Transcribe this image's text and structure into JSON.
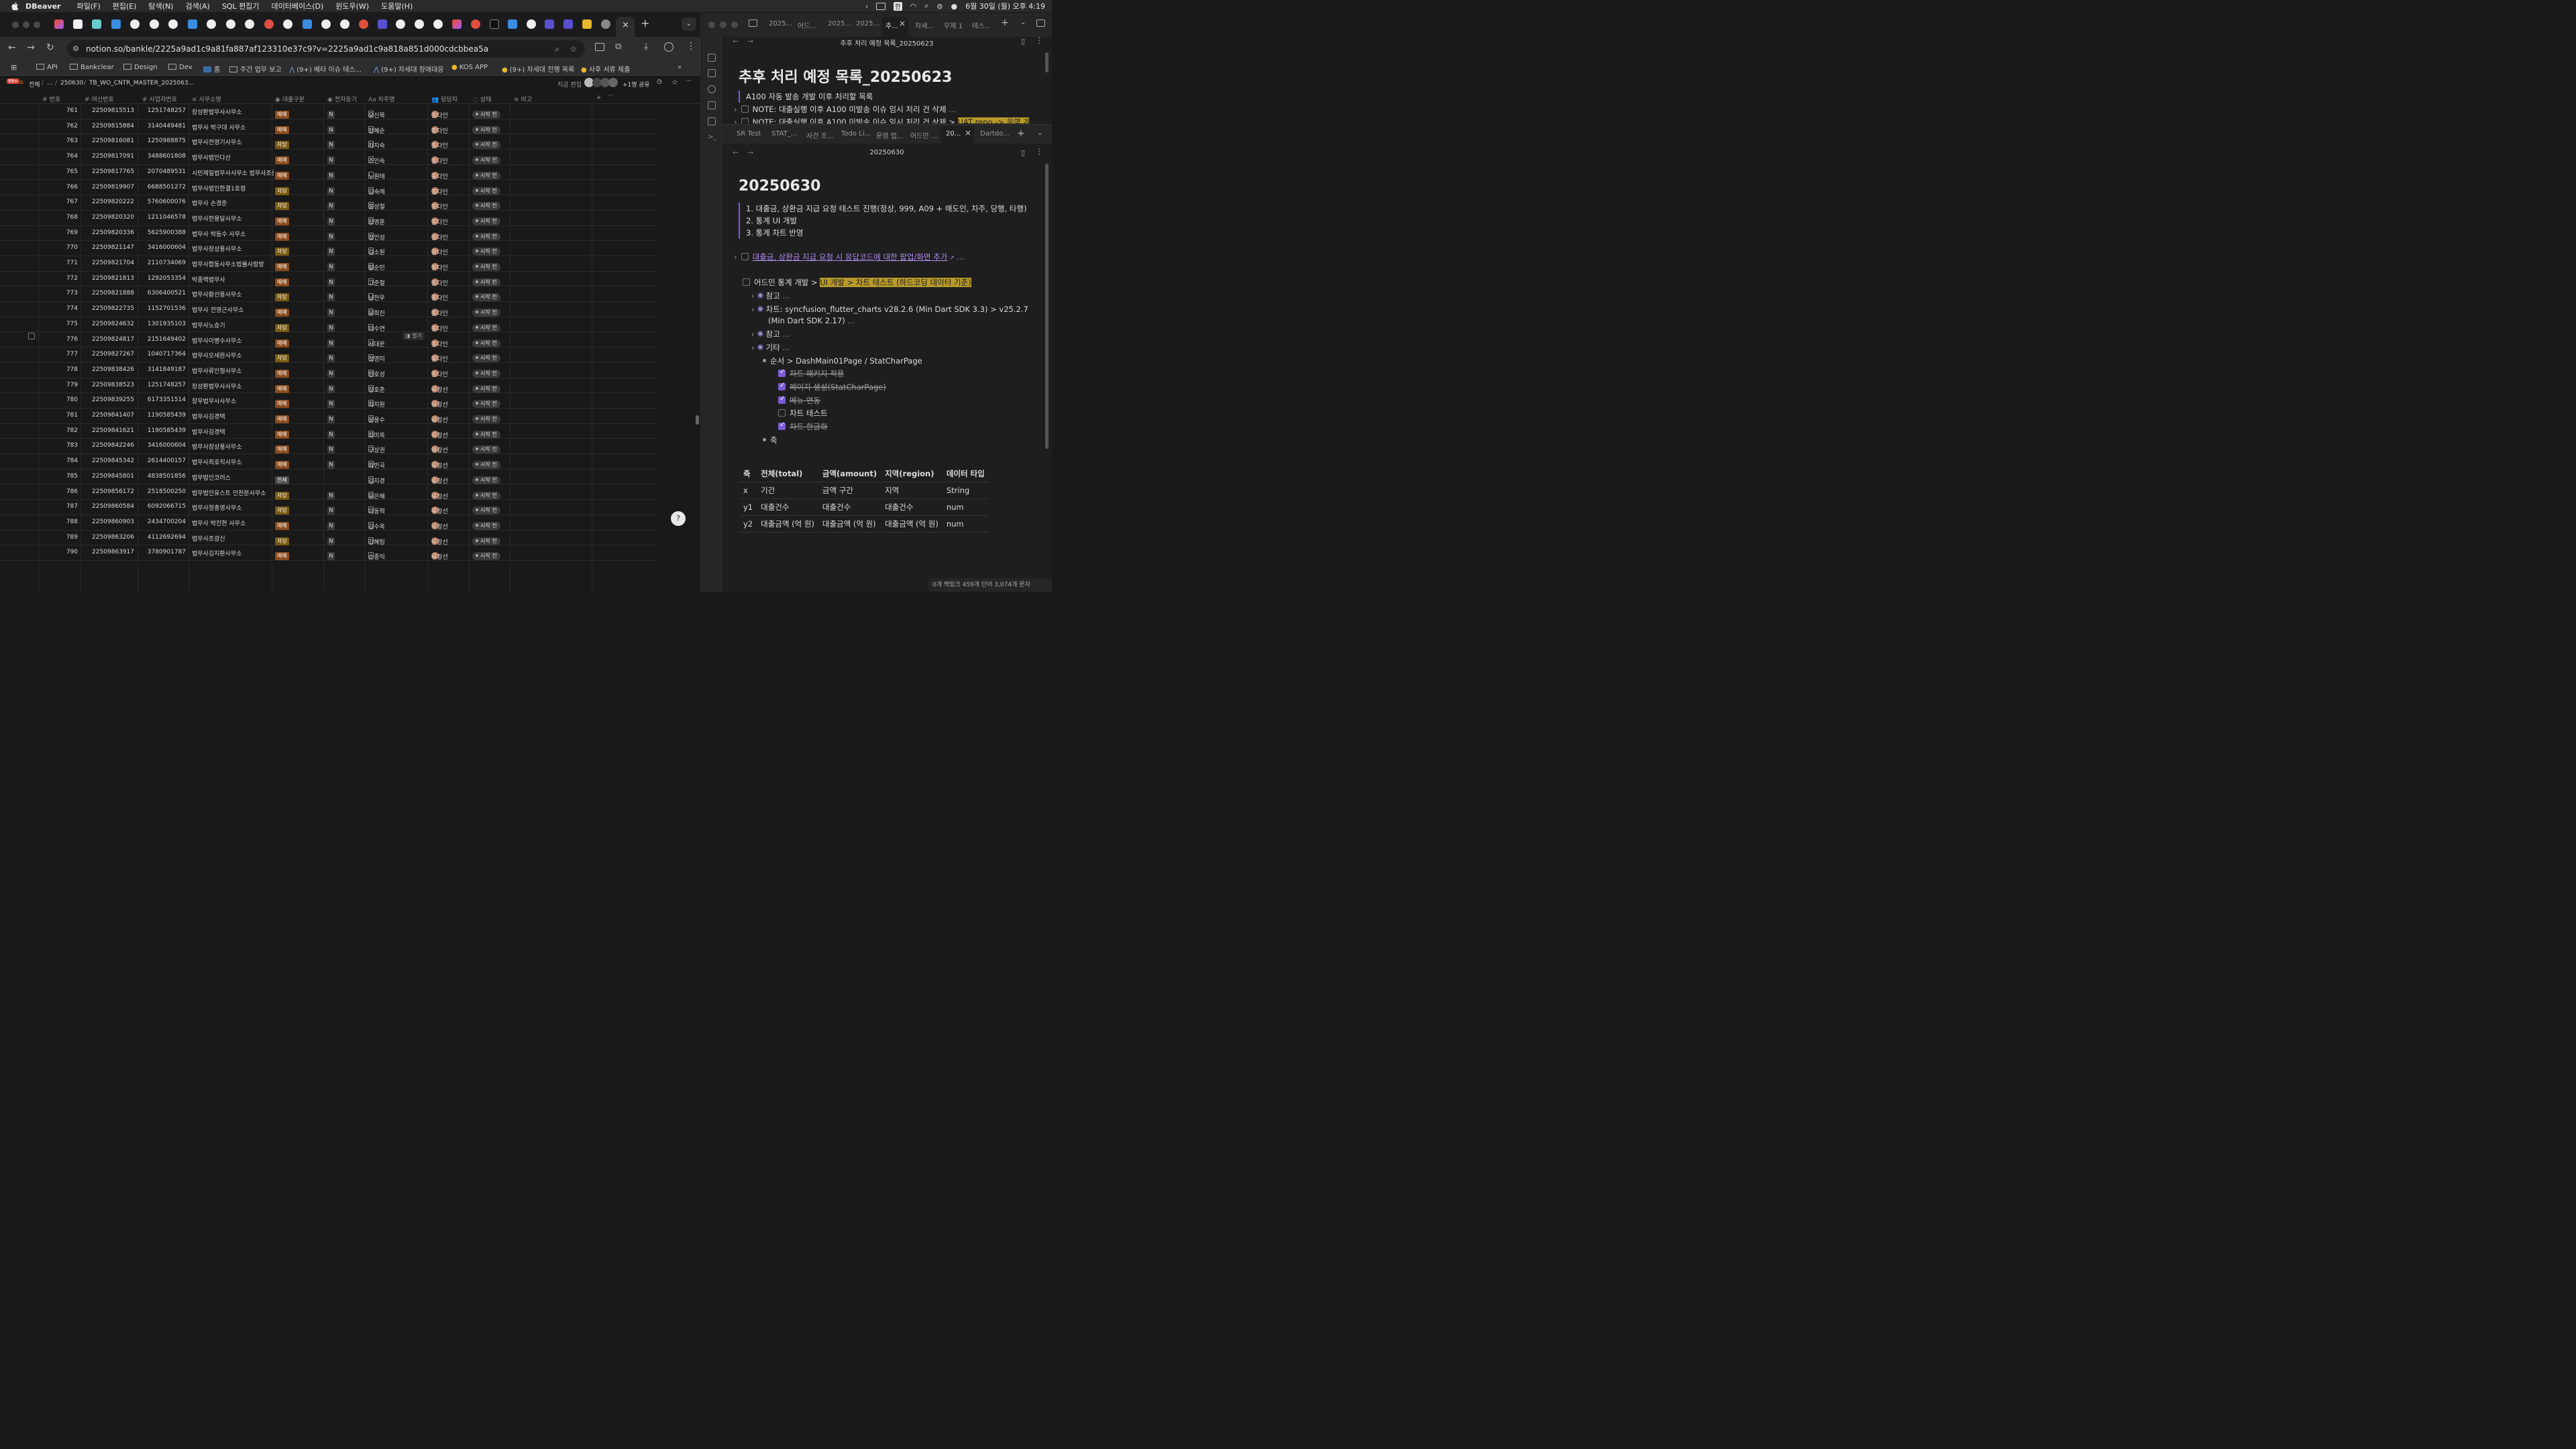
{
  "menubar": {
    "app": "DBeaver",
    "items": [
      "파일(F)",
      "편집(E)",
      "탐색(N)",
      "검색(A)",
      "SQL 편집기",
      "데이터베이스(D)",
      "윈도우(W)",
      "도움말(H)"
    ],
    "clock": "6월 30일 (월) 오후 4:19"
  },
  "browser": {
    "url": "notion.so/bankle/2225a9ad1c9a81fa887af123310e37c9?v=2225a9ad1c9a818a851d000cdcbbea5a",
    "bookmarks": [
      "API",
      "Bankclear",
      "Design",
      "Dev",
      "홈",
      "주간 업무 보고",
      "(9+) 베타 이슈 테스...",
      "(9+) 차세대 장애대응",
      "KOS APP",
      "(9+) 차세대 진행 목록",
      "사후 서류 제출"
    ]
  },
  "notion": {
    "breadcrumb": {
      "badge": "99+",
      "items": [
        "전체",
        "...",
        "250630",
        "TB_WO_CNTR_MASTER_2025063..."
      ],
      "edit_label": "지금 편집",
      "people_count": "+1명",
      "share": "공유"
    },
    "columns": [
      "번호",
      "여신번호",
      "사업자번호",
      "사무소명",
      "대출구분",
      "전자등기",
      "차주명",
      "담당자",
      "상태",
      "비고"
    ],
    "open_label": "열기",
    "rows": [
      {
        "no": "761",
        "loan": "22509815513",
        "biz": "1251748257",
        "office": "장성환법무사사무소",
        "type": "매매",
        "e": "N",
        "owner": "유신목",
        "mgr": "홍다인",
        "status": "시작 전"
      },
      {
        "no": "762",
        "loan": "22509815884",
        "biz": "3140449481",
        "office": "법무사 박구대 사무소",
        "type": "매매",
        "e": "N",
        "owner": "장혜순",
        "mgr": "홍다인",
        "status": "시작 전"
      },
      {
        "no": "763",
        "loan": "22509816081",
        "biz": "1250988875",
        "office": "법무사전영기사무소",
        "type": "자담",
        "e": "N",
        "owner": "차지숙",
        "mgr": "홍다인",
        "status": "시작 전"
      },
      {
        "no": "764",
        "loan": "22509817091",
        "biz": "3488601808",
        "office": "법무사법인다산",
        "type": "매매",
        "e": "N",
        "owner": "조인숙",
        "mgr": "홍다인",
        "status": "시작 전"
      },
      {
        "no": "765",
        "loan": "22509817765",
        "biz": "2070489531",
        "office": "시민제일법무사사무소 법무사조중일",
        "type": "매매",
        "e": "N",
        "owner": "노원태",
        "mgr": "홍다인",
        "status": "시작 전"
      },
      {
        "no": "766",
        "loan": "22509819907",
        "biz": "6688501272",
        "office": "법무사법인한결1호점",
        "type": "자담",
        "e": "N",
        "owner": "김숙례",
        "mgr": "홍다인",
        "status": "시작 전"
      },
      {
        "no": "767",
        "loan": "22509820222",
        "biz": "5760600076",
        "office": "법무사 손경준",
        "type": "자담",
        "e": "N",
        "owner": "홍성철",
        "mgr": "홍다인",
        "status": "시작 전"
      },
      {
        "no": "768",
        "loan": "22509820320",
        "biz": "1211046578",
        "office": "법무사한용달사무소",
        "type": "매매",
        "e": "N",
        "owner": "장영훈",
        "mgr": "홍다인",
        "status": "시작 전"
      },
      {
        "no": "769",
        "loan": "22509820336",
        "biz": "5625900388",
        "office": "법무사 박동수 사무소",
        "type": "매매",
        "e": "N",
        "owner": "정인성",
        "mgr": "홍다인",
        "status": "시작 전"
      },
      {
        "no": "770",
        "loan": "22509821147",
        "biz": "3416000604",
        "office": "법무사장상용사무소",
        "type": "자담",
        "e": "N",
        "owner": "김소원",
        "mgr": "홍다인",
        "status": "시작 전"
      },
      {
        "no": "771",
        "loan": "22509821704",
        "biz": "2110734069",
        "office": "법무사합동사무소법률사랑방",
        "type": "매매",
        "e": "N",
        "owner": "황순민",
        "mgr": "홍다인",
        "status": "시작 전"
      },
      {
        "no": "772",
        "loan": "22509821813",
        "biz": "1292053354",
        "office": "박종백법무사",
        "type": "매매",
        "e": "N",
        "owner": "고준철",
        "mgr": "홍다인",
        "status": "시작 전"
      },
      {
        "no": "773",
        "loan": "22509821888",
        "biz": "6306400521",
        "office": "법무사황선용사무소",
        "type": "자담",
        "e": "N",
        "owner": "남천우",
        "mgr": "홍다인",
        "status": "시작 전"
      },
      {
        "no": "774",
        "loan": "22509822735",
        "biz": "1152701536",
        "office": "법무사 전영근사무소",
        "type": "매매",
        "e": "N",
        "owner": "유희진",
        "mgr": "홍다인",
        "status": "시작 전"
      },
      {
        "no": "775",
        "loan": "22509824632",
        "biz": "1301935103",
        "office": "법무사노승기",
        "type": "자담",
        "e": "N",
        "owner": "이수연",
        "mgr": "홍다인",
        "status": "시작 전"
      },
      {
        "no": "776",
        "loan": "22509824817",
        "biz": "2151649402",
        "office": "법무사이병수사무소",
        "type": "매매",
        "e": "N",
        "owner": "서대운",
        "mgr": "홍다인",
        "status": "시작 전"
      },
      {
        "no": "777",
        "loan": "22509827267",
        "biz": "1040717364",
        "office": "법무사오세완사무소",
        "type": "자담",
        "e": "N",
        "owner": "정영미",
        "mgr": "홍다인",
        "status": "시작 전"
      },
      {
        "no": "778",
        "loan": "22509838426",
        "biz": "3141849187",
        "office": "법무사류인형사무소",
        "type": "매매",
        "e": "N",
        "owner": "한호성",
        "mgr": "홍다인",
        "status": "시작 전"
      },
      {
        "no": "779",
        "loan": "22509838523",
        "biz": "1251748257",
        "office": "장성환법무사사무소",
        "type": "매매",
        "e": "N",
        "owner": "장호춘",
        "mgr": "류창선",
        "status": "시작 전"
      },
      {
        "no": "780",
        "loan": "22509839255",
        "biz": "6173351514",
        "office": "창우법무사사무소",
        "type": "매매",
        "e": "N",
        "owner": "최지원",
        "mgr": "류창선",
        "status": "시작 전"
      },
      {
        "no": "781",
        "loan": "22509841407",
        "biz": "1190585439",
        "office": "법무사김경택",
        "type": "매매",
        "e": "N",
        "owner": "윤용수",
        "mgr": "류창선",
        "status": "시작 전"
      },
      {
        "no": "782",
        "loan": "22509841621",
        "biz": "1190585439",
        "office": "법무사김경택",
        "type": "매매",
        "e": "N",
        "owner": "최미옥",
        "mgr": "류창선",
        "status": "시작 전"
      },
      {
        "no": "783",
        "loan": "22509842246",
        "biz": "3416000604",
        "office": "법무사장상용사무소",
        "type": "매매",
        "e": "N",
        "owner": "구상권",
        "mgr": "류창선",
        "status": "시작 전"
      },
      {
        "no": "784",
        "loan": "22509845342",
        "biz": "2614400157",
        "office": "법무사최호직사무소",
        "type": "매매",
        "e": "N",
        "owner": "최민국",
        "mgr": "류창선",
        "status": "시작 전"
      },
      {
        "no": "785",
        "loan": "22509845801",
        "biz": "4838501856",
        "office": "법무법인코러스",
        "type": "전세",
        "e": "",
        "owner": "김지경",
        "mgr": "류창선",
        "status": "시작 전"
      },
      {
        "no": "786",
        "loan": "22509856172",
        "biz": "2518500250",
        "office": "법무법인유스트 인천분사무소",
        "type": "자담",
        "e": "N",
        "owner": "유은혜",
        "mgr": "류창선",
        "status": "시작 전"
      },
      {
        "no": "787",
        "loan": "22509860584",
        "biz": "6092066715",
        "office": "법무사정충영사무소",
        "type": "자담",
        "e": "N",
        "owner": "이동혁",
        "mgr": "류창선",
        "status": "시작 전"
      },
      {
        "no": "788",
        "loan": "22509860903",
        "biz": "2434700204",
        "office": "법무사 박진현 사무소",
        "type": "매매",
        "e": "N",
        "owner": "김수옥",
        "mgr": "류창선",
        "status": "시작 전"
      },
      {
        "no": "789",
        "loan": "22509863206",
        "biz": "4112692694",
        "office": "법무사조광신",
        "type": "자담",
        "e": "N",
        "owner": "강혜림",
        "mgr": "류창선",
        "status": "시작 전"
      },
      {
        "no": "790",
        "loan": "22509863917",
        "biz": "3780901787",
        "office": "법무사김지환사무소",
        "type": "매매",
        "e": "N",
        "owner": "손종익",
        "mgr": "류창선",
        "status": "시작 전"
      }
    ]
  },
  "obsidian": {
    "top_tabs": [
      "2025...",
      "어드...",
      "2025...",
      "2025...",
      "추...",
      "차세...",
      "무제 1",
      "테스..."
    ],
    "top_pane_title": "추후 처리 예정 목록_20250623",
    "top_heading": "추후 처리 예정 목록_20250623",
    "top_quote": "A100 자동 발송 개발 이후 처리할 목록",
    "top_note1": "NOTE: 대출실행 이후 A100 미발송 이슈 임시 처리 건 삭제",
    "top_note2": "NOTE: 대출실행 이후 A100 미발송 이슈 임시 처리 건 삭제 > ",
    "top_note2_hl": "UAT repo -> 운영 개",
    "bottom_tabs": [
      "SR Test",
      "STAT_...",
      "사건 조...",
      "Todo Li...",
      "운영 업...",
      "어드민 ...",
      "20...",
      "Dartdo..."
    ],
    "bottom_pane_title": "20250630",
    "bottom_heading": "20250630",
    "list": [
      "1. 대출금, 상환금 지급 요청 테스트 진행(정상, 999, A09 + 매도인, 차주, 당행, 타행)",
      "2. 통계 UI 개발",
      "3. 통계 차트 반영"
    ],
    "link_task": "대출금, 상환금 지급 요청 시 응답코드에 대한 팝업/화면 추가",
    "task_pre": "어드민 통계 개발 > ",
    "task_hl": "UI 개발 >  차트 테스트 (하드코딩 데이터 기준)",
    "sub_ref1": "참고",
    "sub_chart1": "차트: syncfusion_flutter_charts v28.2.6 (Min Dart SDK 3.3) > v25.2.7",
    "sub_chart2": "(Min Dart SDK 2.17)",
    "sub_ref2": "참고",
    "sub_etc": "기타",
    "sub_order": "순서 > DashMain01Page / StatCharPage",
    "checks": [
      {
        "label": "차트 패키지 적용",
        "done": true
      },
      {
        "label": "페이지 생성(StatCharPage)",
        "done": true
      },
      {
        "label": "메뉴 연동",
        "done": true
      },
      {
        "label": "차트 테스트",
        "done": false
      },
      {
        "label": "차트 한글화",
        "done": true
      }
    ],
    "axis_label": "축",
    "table_headers": [
      "축",
      "전체(total)",
      "금액(amount)",
      "지역(region)",
      "데이터 타입"
    ],
    "table_rows": [
      [
        "x",
        "기간",
        "금액 구간",
        "지역",
        "String"
      ],
      [
        "y1",
        "대출건수",
        "대출건수",
        "대출건수",
        "num"
      ],
      [
        "y2",
        "대출금액 (억 원)",
        "대출금액 (억 원)",
        "대출금액 (억 원)",
        "num"
      ]
    ],
    "status_bar": "0개 백링크   459개 단어   3,074개 문자"
  }
}
